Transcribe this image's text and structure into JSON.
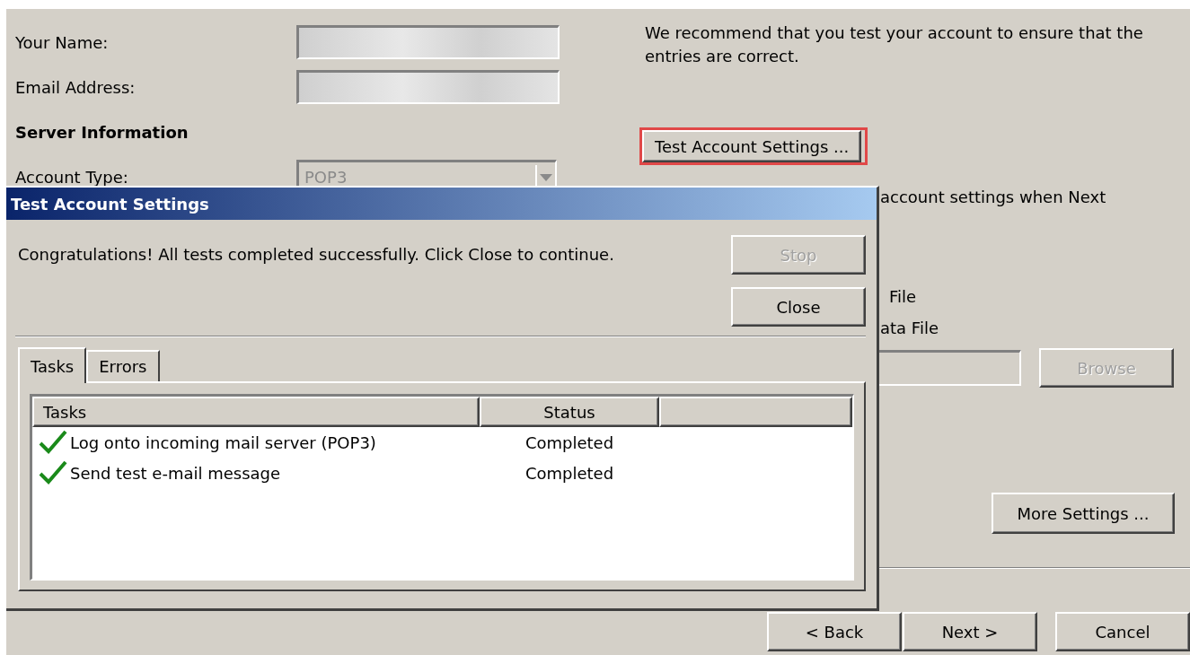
{
  "wizard": {
    "fields": [
      {
        "label": "Your Name:"
      },
      {
        "label": "Email Address:"
      }
    ],
    "section_heading": "Server Information",
    "account_type": {
      "label": "Account Type:",
      "value": "POP3",
      "disabled": true
    },
    "recommendation": "We recommend that you test your account to ensure that the entries are correct.",
    "test_button": {
      "label": "Test Account Settings ...",
      "highlighted": true
    },
    "checkbox_label_fragment": "account settings when Next",
    "option_1_fragment": "File",
    "option_2_fragment": "ata File",
    "browse_button": {
      "label": "Browse",
      "disabled": true
    },
    "more_settings_button": {
      "label": "More Settings ..."
    },
    "nav_buttons": [
      {
        "label": "< Back"
      },
      {
        "label": "Next >"
      },
      {
        "label": "Cancel"
      }
    ]
  },
  "dialog": {
    "title": "Test Account Settings",
    "message": "Congratulations! All tests completed successfully. Click Close to continue.",
    "buttons": [
      {
        "label": "Stop",
        "disabled": true
      },
      {
        "label": "Close",
        "disabled": false
      }
    ],
    "tabs": [
      {
        "label": "Tasks",
        "selected": true
      },
      {
        "label": "Errors",
        "selected": false
      }
    ],
    "table": {
      "columns": [
        "Tasks",
        "Status"
      ],
      "rows": [
        {
          "task": "Log onto incoming mail server (POP3)",
          "status": "Completed",
          "done": true
        },
        {
          "task": "Send test e-mail message",
          "status": "Completed",
          "done": true
        }
      ]
    }
  }
}
